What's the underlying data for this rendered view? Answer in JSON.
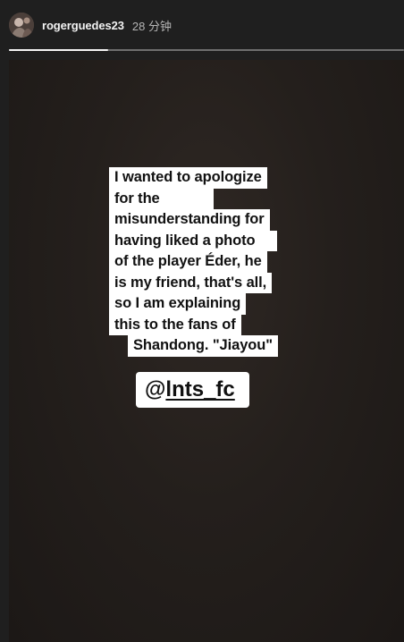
{
  "header": {
    "username": "rogerguedes23",
    "time": "28 分钟",
    "avatar_icon": "user-avatar-icon"
  },
  "progress": {
    "fraction": 0.25,
    "segments": 1
  },
  "story": {
    "caption_lines": [
      "I wanted to apologize",
      "for the",
      "misunderstanding for",
      "having liked a photo",
      "of the player Éder, he",
      "is my friend, that's all,",
      "so I am explaining",
      "this to the fans of",
      "Shandong. \"Jiayou\""
    ],
    "mention_at": "@",
    "mention_handle": "lnts_fc"
  },
  "colors": {
    "background": "#1f1f1f",
    "caption_bg": "#ffffff",
    "caption_text": "#111111",
    "progress_fill": "#f5f5f5",
    "progress_track": "#6f6f6f"
  }
}
